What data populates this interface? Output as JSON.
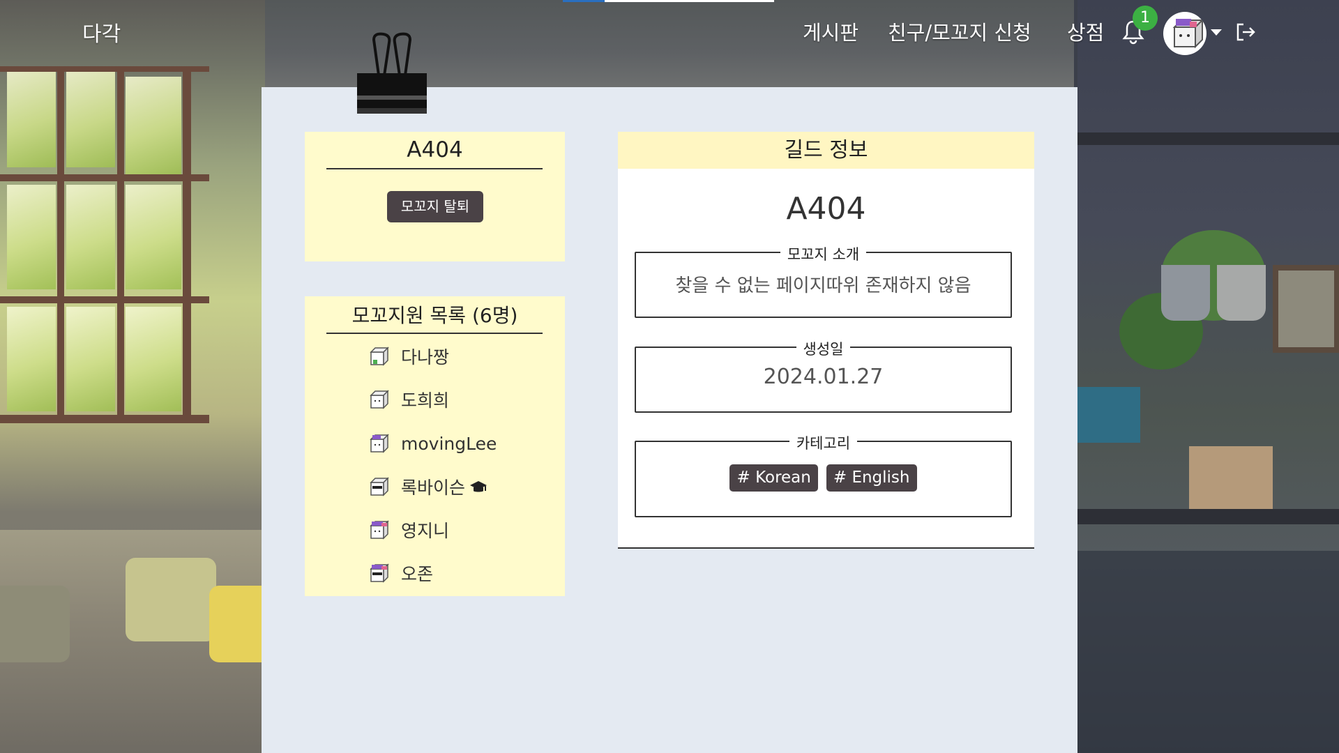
{
  "nav": {
    "brand": "다각",
    "links": [
      "게시판",
      "친구/모꼬지 신청",
      "상점"
    ],
    "notification_count": "1",
    "icons": {
      "bell": "bell-icon",
      "avatar": "user-avatar",
      "caret": "caret-down-icon",
      "logout": "logout-icon"
    }
  },
  "side": {
    "guild_title": "A404",
    "leave_button": "모꼬지 탈퇴",
    "members_title": "모꼬지원 목록 (6명)",
    "members": [
      {
        "name": "다나짱",
        "avatar": "green"
      },
      {
        "name": "도희희",
        "avatar": "plain"
      },
      {
        "name": "movingLee",
        "avatar": "purple"
      },
      {
        "name": "록바이슨",
        "avatar": "sunglasses",
        "leader_icon": "graduation-cap-icon"
      },
      {
        "name": "영지니",
        "avatar": "purple-hat"
      },
      {
        "name": "오존",
        "avatar": "purple-sunglasses"
      }
    ]
  },
  "guild": {
    "header": "길드 정보",
    "name": "A404",
    "intro_label": "모꼬지 소개",
    "intro_value": "찾을 수 없는 페이지따위 존재하지 않음",
    "created_label": "생성일",
    "created_value": "2024.01.27",
    "category_label": "카테고리",
    "categories": [
      "# Korean",
      "# English"
    ]
  },
  "colors": {
    "card_bg": "#fffbcc",
    "panel_bg": "#e4eaf2",
    "button_bg": "#4a4246",
    "badge_green": "#3cb043"
  }
}
